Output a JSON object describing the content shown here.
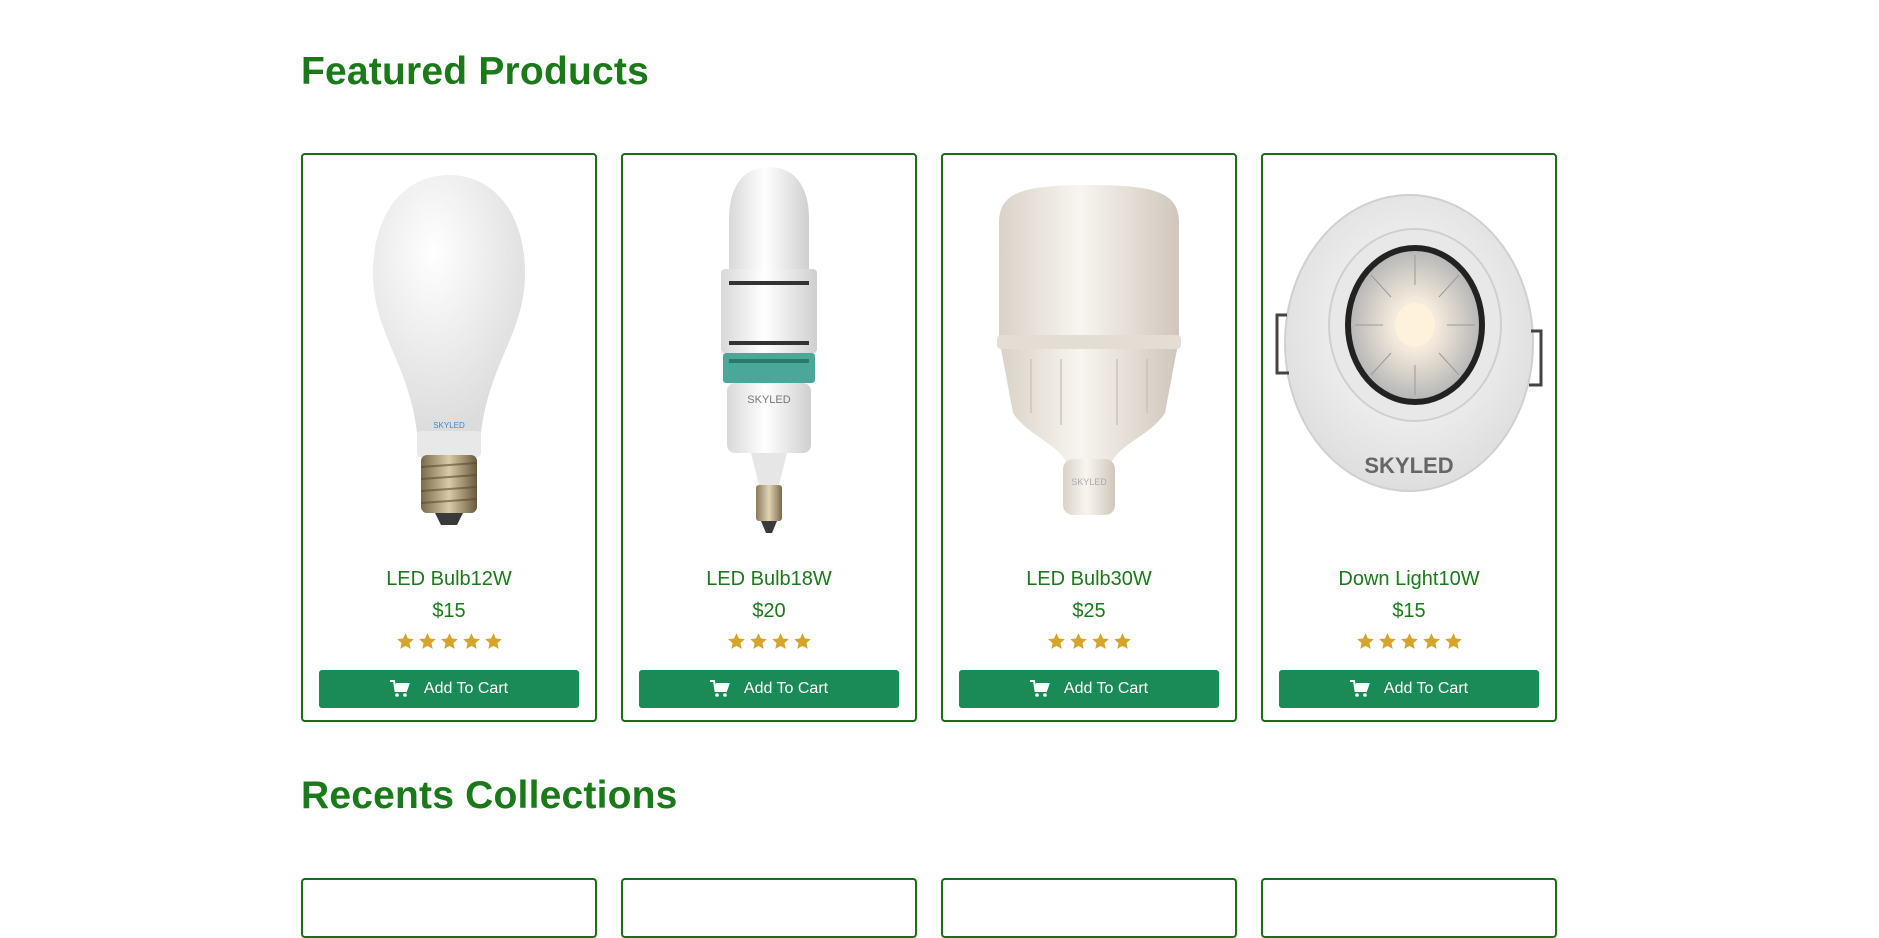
{
  "featured": {
    "title": "Featured Products",
    "products": [
      {
        "name": "LED Bulb12W",
        "price": "$15",
        "rating": 5,
        "button_label": "Add To Cart",
        "brand_print": "SKYLED"
      },
      {
        "name": "LED Bulb18W",
        "price": "$20",
        "rating": 4,
        "button_label": "Add To Cart",
        "brand_print": "SKYLED"
      },
      {
        "name": "LED Bulb30W",
        "price": "$25",
        "rating": 4,
        "button_label": "Add To Cart",
        "brand_print": "SKYLED"
      },
      {
        "name": "Down Light10W",
        "price": "$15",
        "rating": 5,
        "button_label": "Add To Cart",
        "brand_print": "SKYLED"
      }
    ]
  },
  "recents": {
    "title": "Recents Collections"
  },
  "colors": {
    "heading": "#1a7a1a",
    "card_border": "#1a6b1a",
    "button_bg": "#1a8a57",
    "star": "#d4a52a"
  },
  "icons": {
    "star": "star-icon",
    "cart": "shopping-cart-icon"
  }
}
